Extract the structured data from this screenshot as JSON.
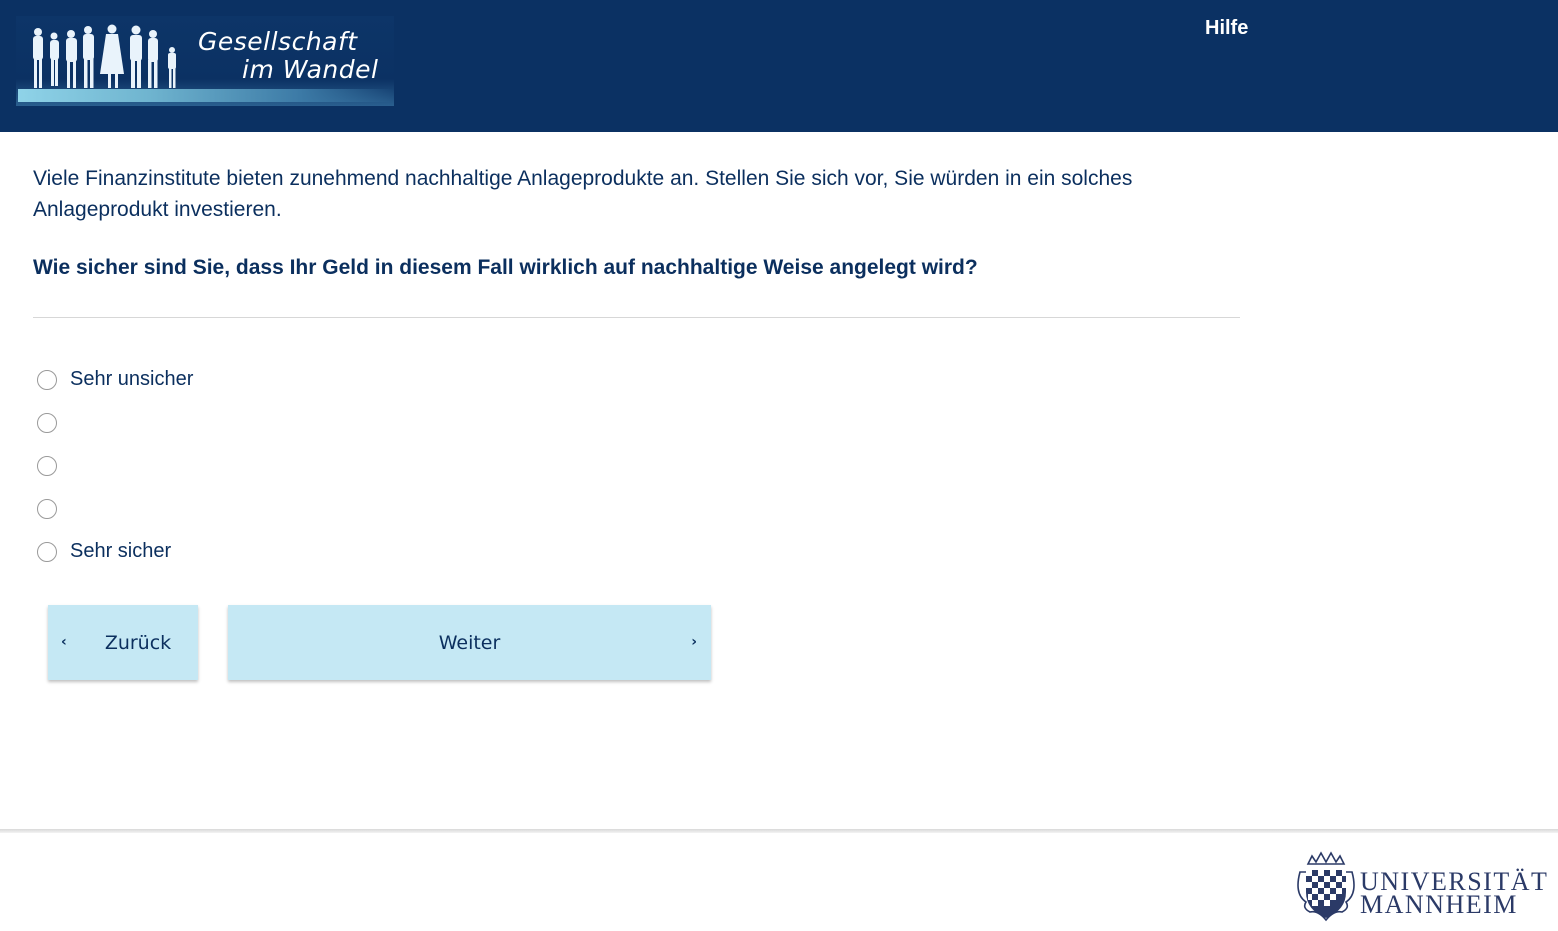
{
  "header": {
    "logo": {
      "line1": "Gesellschaft",
      "line2": "im Wandel"
    },
    "help_link": "Hilfe",
    "bg_color": "#0b3163"
  },
  "survey": {
    "intro": "Viele Finanzinstitute bieten zunehmend nachhaltige Anlageprodukte an. Stellen Sie sich vor, Sie würden in ein solches Anlageprodukt investieren.",
    "question": "Wie sicher sind Sie, dass Ihr Geld in diesem Fall wirklich auf nachhaltige Weise angelegt wird?",
    "options": [
      {
        "label": "Sehr unsicher",
        "selected": false
      },
      {
        "label": "",
        "selected": false
      },
      {
        "label": "",
        "selected": false
      },
      {
        "label": "",
        "selected": false
      },
      {
        "label": "Sehr sicher",
        "selected": false
      }
    ]
  },
  "navigation": {
    "back_label": "Zurück",
    "next_label": "Weiter",
    "button_color": "#c5e8f4"
  },
  "footer": {
    "university": {
      "line1": "UNIVERSITÄT",
      "line2": "MANNHEIM"
    }
  }
}
